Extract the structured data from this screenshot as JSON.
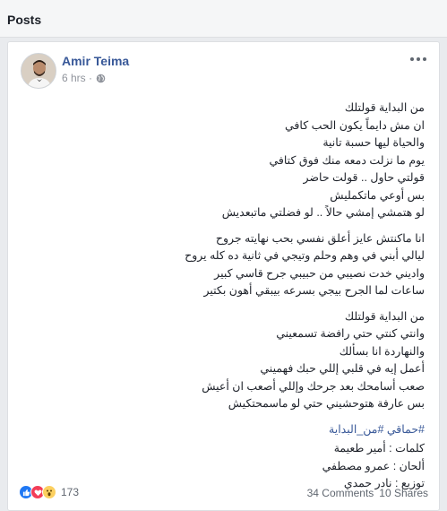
{
  "header": {
    "title": "Posts"
  },
  "post": {
    "author": "Amir Teima",
    "time": "6 hrs ·",
    "lines": [
      "من البداية قولتلك",
      "ان مش دايماً يكون الحب كافي",
      "والحياة ليها حسبة تانية",
      "يوم ما نزلت دمعه منك فوق كتافي",
      "قولتي حاول .. قولت حاضر",
      "بس أوعي ماتكمليش",
      "لو هتمشي إمشي حالاً .. لو فضلتي ماتبعديش",
      "",
      "انا ماكنتش عايز أعلق نفسي بحب نهايته جروح",
      "ليالي أبني في وهم وحلم وتيجي في ثانية ده كله يروح",
      "واديني خدت نصيبي من حبيبي جرح قاسي كبير",
      "ساعات لما الجرح بيجي بسرعه بيبقي أهون بكتير",
      "",
      "من البداية قولتلك",
      "وانتي كنتي حتي رافضة تسمعيني",
      "والنهاردة انا بسألك",
      "أعمل إيه في قلبي إللي حبك فهميني",
      "صعب أسامحك بعد جرحك وإللي أصعب ان أعيش",
      "بس عارفة هتوحشيني حتي لو ماسمحتكيش"
    ],
    "hashtags": "#حماقي #من_البداية",
    "credits": [
      "كلمات : أمير طعيمة",
      "ألحان : عمرو مصطفي",
      "توزيع : نادر حمدي"
    ]
  },
  "reactions": {
    "count": "173",
    "icons": [
      "like-icon",
      "love-icon",
      "wow-icon"
    ],
    "colors": {
      "like": "#2078f4",
      "love": "#f33e58",
      "wow": "#fcd060"
    }
  },
  "stats": {
    "comments": "34 Comments",
    "shares": "10 Shares"
  },
  "colors": {
    "link": "#385898",
    "meta": "#90949c",
    "background": "#e9ebee"
  }
}
